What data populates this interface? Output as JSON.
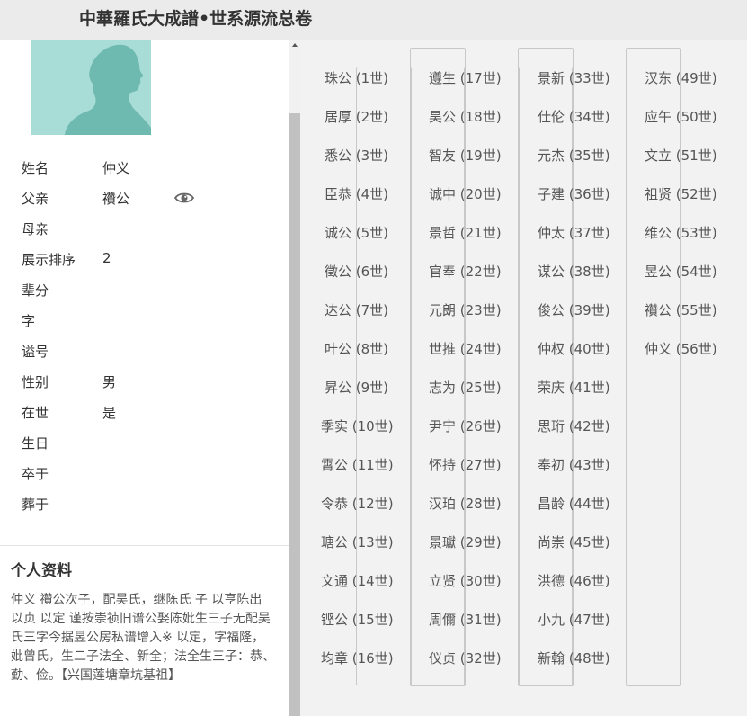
{
  "header": {
    "title": "中華羅氏大成譜•世系源流总卷"
  },
  "person": {
    "fields": [
      {
        "label": "姓名",
        "value": "仲义"
      },
      {
        "label": "父亲",
        "value": "禶公"
      },
      {
        "label": "母亲",
        "value": ""
      },
      {
        "label": "展示排序",
        "value": "2"
      },
      {
        "label": "辈分",
        "value": ""
      },
      {
        "label": "字",
        "value": ""
      },
      {
        "label": "谥号",
        "value": ""
      },
      {
        "label": "性别",
        "value": "男"
      },
      {
        "label": "在世",
        "value": "是"
      },
      {
        "label": "生日",
        "value": ""
      },
      {
        "label": "卒于",
        "value": ""
      },
      {
        "label": "葬于",
        "value": ""
      }
    ]
  },
  "bio": {
    "title": "个人资料",
    "text": "仲义  禶公次子，配吴氏，继陈氏  子  以亨陈出  以贞 以定 谨按崇祯旧谱公娶陈妣生三子无配吴氏三字今据昱公房私谱增入※  以定，字福隆，妣曾氏，生二子法全、新全；法全生三子：恭、勤、俭。【兴国莲塘章坑基祖】"
  },
  "generations": [
    "珠公 (1世)",
    "居厚 (2世)",
    "悉公 (3世)",
    "臣恭 (4世)",
    "诚公 (5世)",
    "徵公 (6世)",
    "达公 (7世)",
    "叶公 (8世)",
    "昇公 (9世)",
    "季实 (10世)",
    "霄公 (11世)",
    "令恭 (12世)",
    "瑭公 (13世)",
    "文通 (14世)",
    "铿公 (15世)",
    "均章 (16世)",
    "遵生 (17世)",
    "昊公 (18世)",
    "智友 (19世)",
    "诚中 (20世)",
    "景哲 (21世)",
    "官奉 (22世)",
    "元朗 (23世)",
    "世推 (24世)",
    "志为 (25世)",
    "尹宁 (26世)",
    "怀持 (27世)",
    "汉珀 (28世)",
    "景瓛 (29世)",
    "立贤 (30世)",
    "周儞 (31世)",
    "仪贞 (32世)",
    "景新 (33世)",
    "仕伦 (34世)",
    "元杰 (35世)",
    "子建 (36世)",
    "仲太 (37世)",
    "谋公 (38世)",
    "俊公 (39世)",
    "仲权 (40世)",
    "荣庆 (41世)",
    "思珩 (42世)",
    "奉初 (43世)",
    "昌龄 (44世)",
    "尚崇 (45世)",
    "洪德 (46世)",
    "小九 (47世)",
    "新翰 (48世)",
    "汉东 (49世)",
    "应午 (50世)",
    "文立 (51世)",
    "祖贤 (52世)",
    "维公 (53世)",
    "昱公 (54世)",
    "禶公 (55世)",
    "仲义 (56世)"
  ],
  "colors": {
    "header_bg": "#ebebeb",
    "avatar_bg": "#a8dcd6",
    "avatar_silhouette": "#6fbab0",
    "right_panel_bg": "#f2f2f2"
  },
  "icons": {
    "father_view": "eye-icon",
    "avatar": "person-silhouette-icon",
    "scroll_up": "scroll-up-arrow-icon"
  }
}
